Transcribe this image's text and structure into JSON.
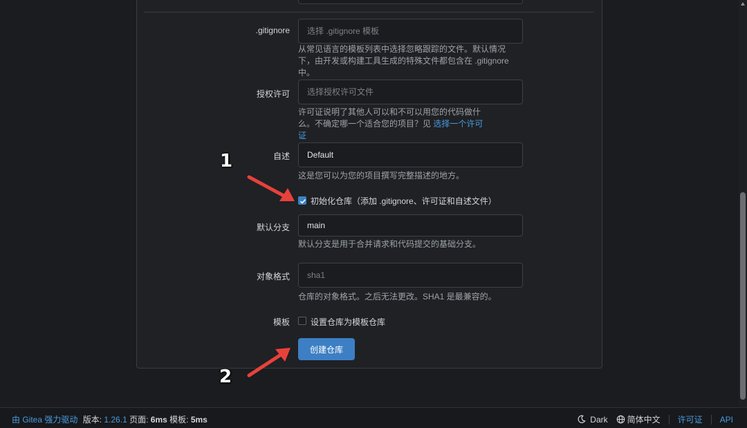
{
  "form": {
    "gitignore": {
      "label": ".gitignore",
      "placeholder": "选择 .gitignore 模板",
      "help": "从常见语言的模板列表中选择忽略跟踪的文件。默认情况下，由开发或构建工具生成的特殊文件都包含在 .gitignore 中。"
    },
    "license": {
      "label": "授权许可",
      "placeholder": "选择授权许可文件",
      "help": "许可证说明了其他人可以和不可以用您的代码做什么。不确定哪一个适合您的项目？见 ",
      "help_link": "选择一个许可证"
    },
    "readme": {
      "label": "自述",
      "value": "Default",
      "help": "这是您可以为您的项目撰写完整描述的地方。"
    },
    "auto_init": {
      "label": "初始化仓库（添加 .gitignore、许可证和自述文件）",
      "checked": true
    },
    "default_branch": {
      "label": "默认分支",
      "value": "main",
      "help": "默认分支是用于合并请求和代码提交的基础分支。"
    },
    "object_format": {
      "label": "对象格式",
      "placeholder": "sha1",
      "help": "仓库的对象格式。之后无法更改。SHA1 是最兼容的。"
    },
    "template": {
      "label": "模板",
      "checkbox_label": "设置仓库为模板仓库",
      "checked": false
    },
    "submit_label": "创建仓库"
  },
  "annotations": {
    "marker_1": "1",
    "marker_2": "2",
    "color": "#e8413c"
  },
  "footer": {
    "powered_by": "由 Gitea 强力驱动",
    "version_label": "版本: ",
    "version": "1.26.1",
    "page_label": " 页面: ",
    "page_time": "6ms",
    "template_label": " 模板: ",
    "template_time": "5ms",
    "theme": "Dark",
    "language": "简体中文",
    "license_link": "许可证",
    "api_link": "API"
  }
}
